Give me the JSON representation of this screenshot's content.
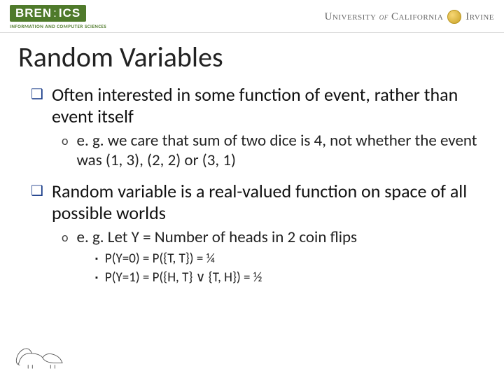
{
  "header": {
    "logo_main": "BREN",
    "logo_suffix": "ICS",
    "logo_sub": "INFORMATION AND COMPUTER SCIENCES",
    "uni_left": "University",
    "uni_mid": "of",
    "uni_cal": "California",
    "uni_irv": "Irvine"
  },
  "title": "Random Variables",
  "bullets": {
    "b1": "Often interested in some function of event, rather than event itself",
    "b1a": "e. g. we care that sum of two dice is 4, not whether the event was (1, 3), (2, 2) or (3, 1)",
    "b2": "Random variable is a real-valued function on space of all possible worlds",
    "b2a": "e. g. Let Y = Number of heads in 2 coin flips",
    "b2a1": "P(Y=0) = P({T, T}) = ¼",
    "b2a2": "P(Y=1) = P({H, T} ∨ {T, H}) = ½"
  }
}
